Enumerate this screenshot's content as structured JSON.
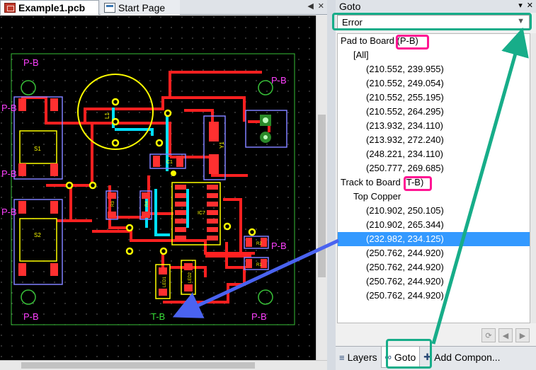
{
  "doc_tabs": {
    "active": "Example1.pcb",
    "inactive": "Start Page"
  },
  "panel": {
    "title": "Goto",
    "combo_value": "Error",
    "tree": [
      {
        "text": "Pad to Board (P-B)",
        "indent": 0
      },
      {
        "text": "[All]",
        "indent": 1
      },
      {
        "text": "(210.552,  239.955)",
        "indent": 2
      },
      {
        "text": "(210.552,  249.054)",
        "indent": 2
      },
      {
        "text": "(210.552,  255.195)",
        "indent": 2
      },
      {
        "text": "(210.552,  264.295)",
        "indent": 2
      },
      {
        "text": "(213.932,  234.110)",
        "indent": 2
      },
      {
        "text": "(213.932,  272.240)",
        "indent": 2
      },
      {
        "text": "(248.221,  234.110)",
        "indent": 2
      },
      {
        "text": "(250.777,  269.685)",
        "indent": 2
      },
      {
        "text": "Track to Board (T-B)",
        "indent": 0
      },
      {
        "text": "Top Copper",
        "indent": 1
      },
      {
        "text": "(210.902,  250.105)",
        "indent": 2
      },
      {
        "text": "(210.902,  265.344)",
        "indent": 2
      },
      {
        "text": "(232.982,  234.125)",
        "indent": 2,
        "selected": true
      },
      {
        "text": "(250.762,  244.920)",
        "indent": 2
      },
      {
        "text": "(250.762,  244.920)",
        "indent": 2
      },
      {
        "text": "(250.762,  244.920)",
        "indent": 2
      },
      {
        "text": "(250.762,  244.920)",
        "indent": 2
      }
    ],
    "bottom_tabs": [
      "Layers",
      "Goto",
      "Add Compon..."
    ]
  },
  "pcb": {
    "labels": {
      "pb": "P-B",
      "tb": "T-B",
      "s1": "S1",
      "s2": "S2",
      "c1": "C1",
      "ic7": "IC7",
      "r1": "R1",
      "r2": "R2",
      "r3": "R3",
      "r4": "R4",
      "l1": "L1",
      "led1": "LED1",
      "led2": "LED2",
      "y1": "Y1"
    }
  },
  "colors": {
    "annotation_pink": "#ff1493",
    "annotation_teal": "#17ad89",
    "arrow_blue": "#4a63f0",
    "selection": "#3399ff"
  }
}
